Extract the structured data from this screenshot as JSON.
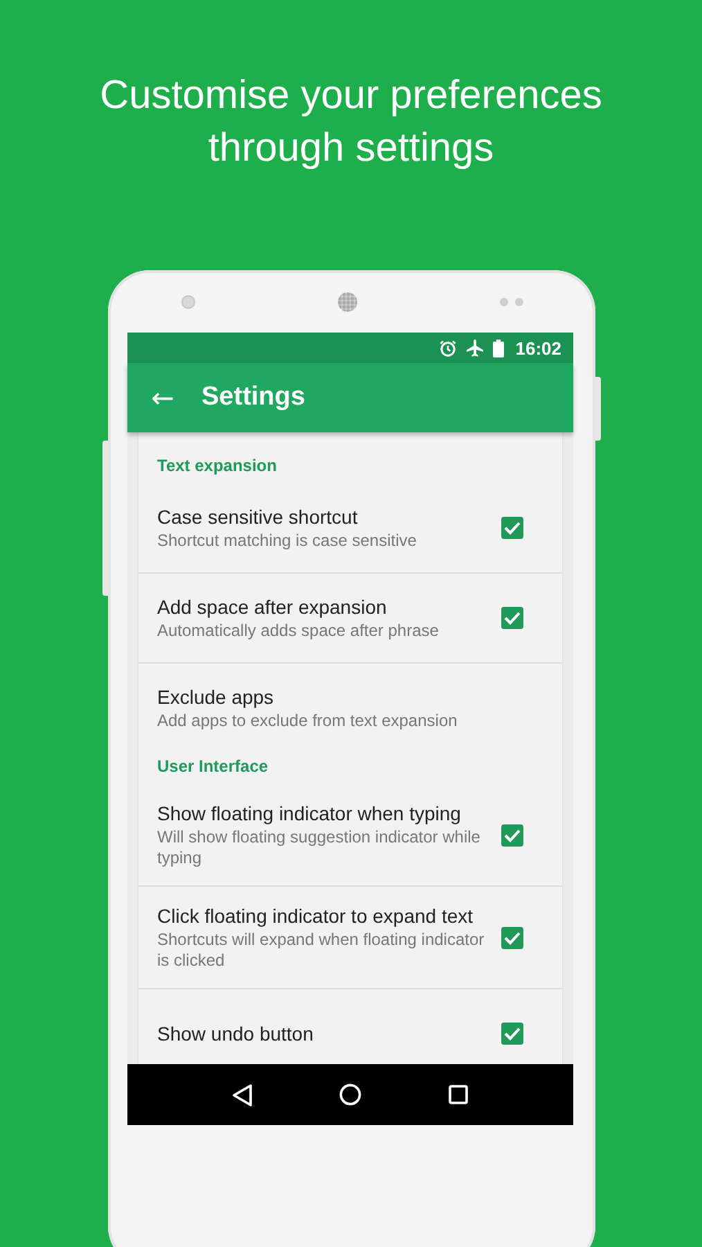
{
  "headline": "Customise your preferences through settings",
  "status_bar": {
    "time": "16:02"
  },
  "app_bar": {
    "back": "←",
    "title": "Settings"
  },
  "settings": [
    {
      "kind": "header",
      "title": "Text expansion"
    },
    {
      "kind": "checkbox",
      "title": "Case sensitive shortcut",
      "summary": "Shortcut matching is case sensitive",
      "checked": true
    },
    {
      "kind": "checkbox",
      "title": "Add space after expansion",
      "summary": "Automatically adds space after phrase",
      "checked": true
    },
    {
      "kind": "link",
      "title": "Exclude apps",
      "summary": "Add apps to exclude from text expansion"
    },
    {
      "kind": "header",
      "title": "User Interface"
    },
    {
      "kind": "checkbox",
      "title": "Show floating indicator when typing",
      "summary": "Will show floating suggestion indicator while typing",
      "checked": true
    },
    {
      "kind": "checkbox",
      "title": "Click floating indicator to expand text",
      "summary": "Shortcuts will expand when floating indicator is clicked",
      "checked": true
    },
    {
      "kind": "checkbox",
      "title": "Show undo button",
      "checked": true
    }
  ]
}
